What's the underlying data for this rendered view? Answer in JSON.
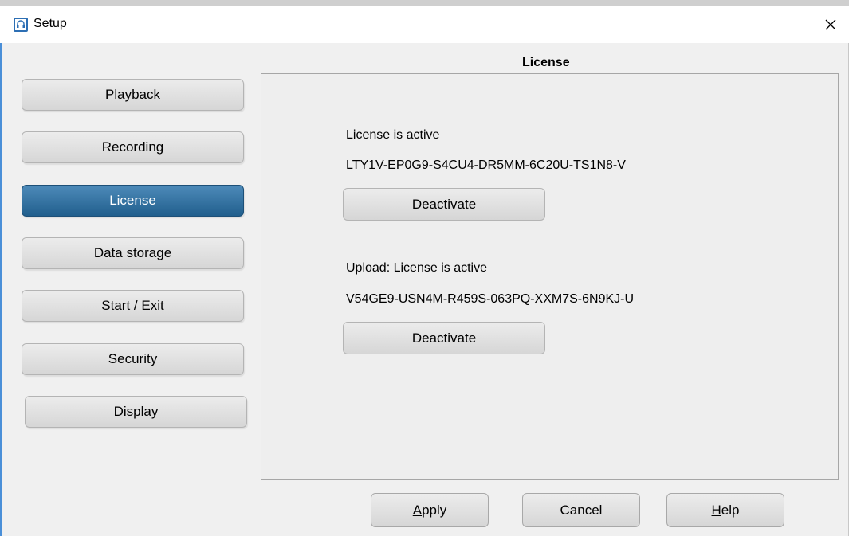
{
  "window": {
    "title": "Setup",
    "icon": "headset-icon",
    "accent": "#2d6fb4"
  },
  "sidebar": {
    "items": [
      {
        "label": "Playback",
        "active": false
      },
      {
        "label": "Recording",
        "active": false
      },
      {
        "label": "License",
        "active": true
      },
      {
        "label": "Data storage",
        "active": false
      },
      {
        "label": "Start / Exit",
        "active": false
      },
      {
        "label": "Security",
        "active": false
      },
      {
        "label": "Display",
        "active": false
      }
    ],
    "active_color": "#215f8d"
  },
  "panel": {
    "title": "License",
    "license": {
      "status": "License is active",
      "key": "LTY1V-EP0G9-S4CU4-DR5MM-6C20U-TS1N8-V",
      "button": "Deactivate"
    },
    "upload": {
      "status": "Upload: License is active",
      "key": "V54GE9-USN4M-R459S-063PQ-XXM7S-6N9KJ-U",
      "button": "Deactivate"
    }
  },
  "footer": {
    "apply": {
      "mnemonic": "A",
      "rest": "pply"
    },
    "cancel": "Cancel",
    "help": {
      "mnemonic": "H",
      "rest": "elp"
    }
  }
}
